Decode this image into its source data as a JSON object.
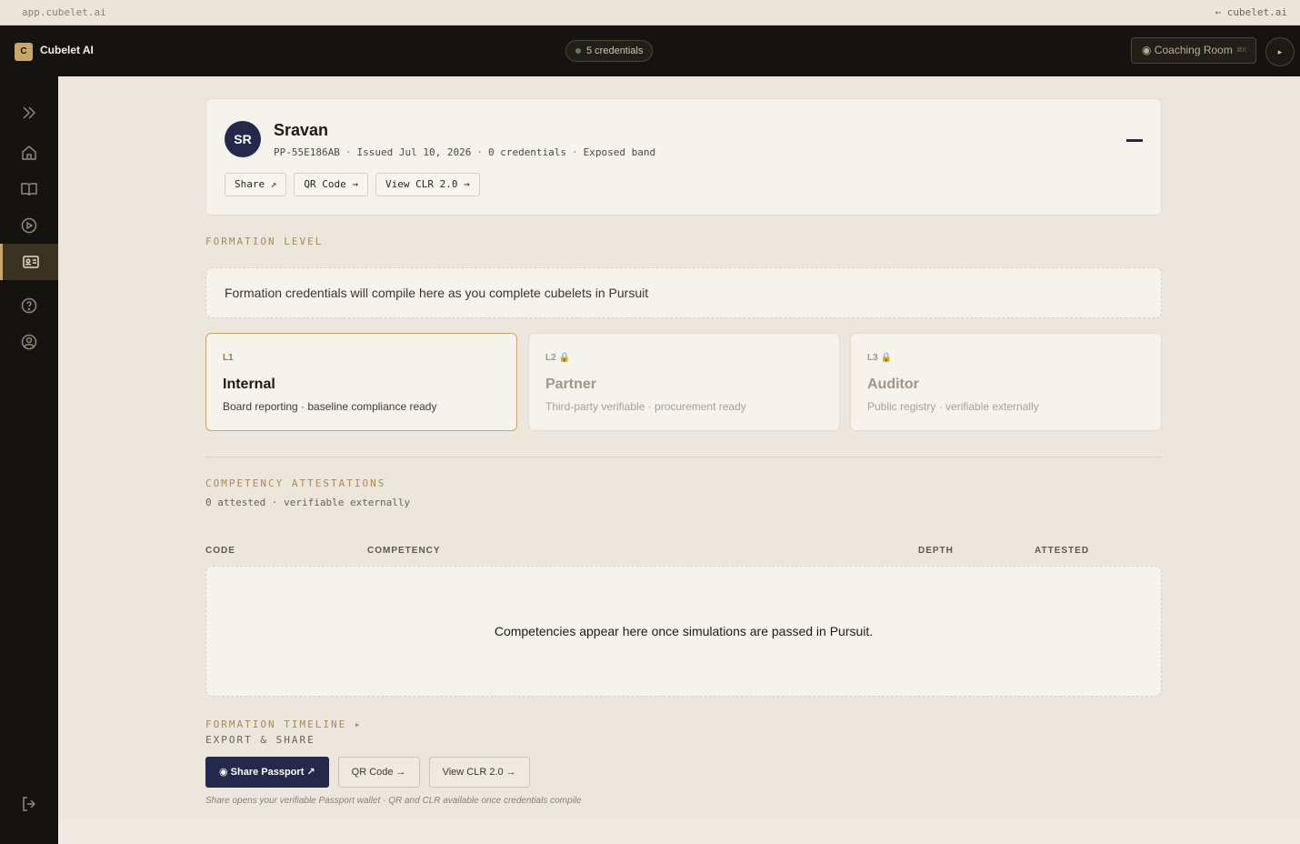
{
  "browser": {
    "url": "app.cubelet.ai",
    "back_link": "← cubelet.ai"
  },
  "topbar": {
    "logo_letter": "C",
    "app_name": "Cubelet AI",
    "credentials_pill": "5 credentials",
    "coaching_room": "◉ Coaching Room",
    "coaching_shortcut": "⌘K",
    "nav_arrow": "▸"
  },
  "sidebar": {
    "icons": [
      "expand-icon",
      "home-icon",
      "book-icon",
      "play-icon",
      "id-card-icon",
      "help-icon",
      "profile-icon",
      "logout-icon"
    ],
    "active": "id-card-icon",
    "accent_color": "#c9a76a"
  },
  "profile": {
    "initials": "SR",
    "name": "Sravan",
    "passport_id": "PP-55E186AB",
    "issued": "Issued Jul 10, 2026",
    "credentials": "0 credentials",
    "band": "Exposed band",
    "actions": [
      "Share ↗",
      "QR Code →",
      "View CLR 2.0 →"
    ]
  },
  "formation": {
    "section_label": "FORMATION LEVEL",
    "notice": "Formation credentials will compile here as you complete cubelets in Pursuit",
    "levels": [
      {
        "code": "L1",
        "title": "Internal",
        "desc": "Board reporting · baseline compliance ready",
        "locked": false
      },
      {
        "code": "L2 🔒",
        "title": "Partner",
        "desc": "Third-party verifiable · procurement ready",
        "locked": true
      },
      {
        "code": "L3 🔒",
        "title": "Auditor",
        "desc": "Public registry · verifiable externally",
        "locked": true
      }
    ]
  },
  "competency": {
    "section_label": "COMPETENCY ATTESTATIONS",
    "summary": "0 attested · verifiable externally",
    "columns": [
      "CODE",
      "COMPETENCY",
      "DEPTH",
      "ATTESTED"
    ],
    "empty_message": "Competencies appear here once simulations are passed in Pursuit."
  },
  "timeline": {
    "section_label": "FORMATION TIMELINE ▸"
  },
  "export": {
    "section_label": "EXPORT & SHARE",
    "share_button": "◉ Share Passport ↗",
    "qr_button": "QR Code →",
    "clr_button": "View CLR 2.0 →",
    "footnote": "Share opens your verifiable Passport wallet · QR and CLR available once credentials compile"
  },
  "colors": {
    "primary": "#24284a",
    "accent": "#c9a76a",
    "background": "#ece6dc",
    "dark": "#15130f"
  }
}
